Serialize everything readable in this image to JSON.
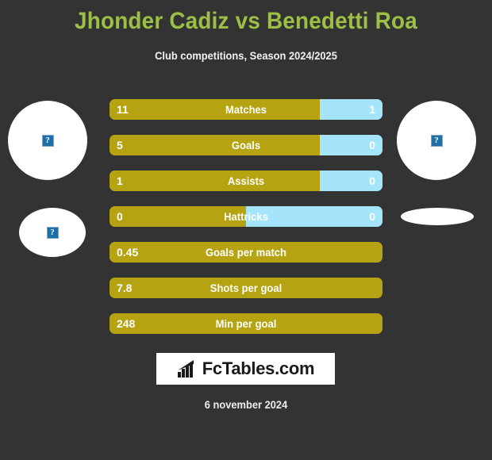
{
  "header": {
    "title": "Jhonder Cadiz vs Benedetti Roa",
    "subtitle": "Club competitions, Season 2024/2025"
  },
  "colors": {
    "background": "#333333",
    "title": "#9DBF45",
    "home_bar": "#B5A312",
    "away_bar": "#A5E5FB",
    "text": "#FFFFFF",
    "logo_background": "#FFFFFF",
    "logo_text": "#1A1A1A"
  },
  "placeholders": {
    "broken_image_glyph": "?",
    "icon_name": "broken-image-icon",
    "left_player_icon": "broken-image-icon",
    "right_player_icon": "broken-image-icon"
  },
  "stats": [
    {
      "label": "Matches",
      "home": "11",
      "away": "1",
      "home_pct": 77,
      "split": true
    },
    {
      "label": "Goals",
      "home": "5",
      "away": "0",
      "home_pct": 77,
      "split": true
    },
    {
      "label": "Assists",
      "home": "1",
      "away": "0",
      "home_pct": 77,
      "split": true
    },
    {
      "label": "Hattricks",
      "home": "0",
      "away": "0",
      "home_pct": 50,
      "split": true
    },
    {
      "label": "Goals per match",
      "home": "0.45",
      "away": "",
      "home_pct": 100,
      "split": false
    },
    {
      "label": "Shots per goal",
      "home": "7.8",
      "away": "",
      "home_pct": 100,
      "split": false
    },
    {
      "label": "Min per goal",
      "home": "248",
      "away": "",
      "home_pct": 100,
      "split": false
    }
  ],
  "logo": {
    "text": "FcTables.com",
    "icon_name": "bar-chart-arrow-icon"
  },
  "footer": {
    "date": "6 november 2024"
  }
}
